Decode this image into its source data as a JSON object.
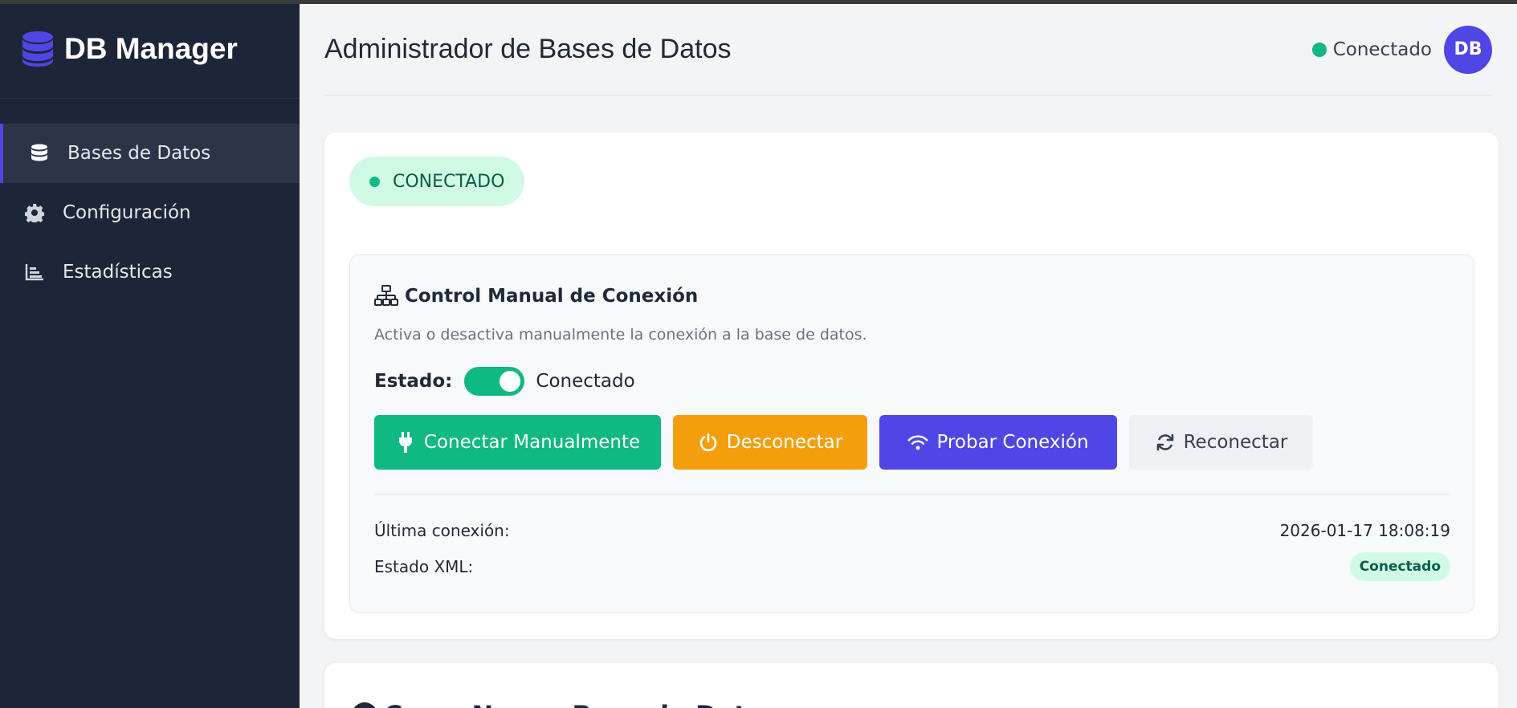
{
  "app": {
    "brand": "DB Manager"
  },
  "sidebar": {
    "items": [
      {
        "label": "Bases de Datos",
        "icon": "database-icon",
        "active": true
      },
      {
        "label": "Configuración",
        "icon": "gear-icon",
        "active": false
      },
      {
        "label": "Estadísticas",
        "icon": "chart-icon",
        "active": false
      }
    ]
  },
  "header": {
    "title": "Administrador de Bases de Datos",
    "status": "Conectado",
    "avatar": "DB"
  },
  "status_card": {
    "pill": "CONECTADO",
    "control": {
      "title": "Control Manual de Conexión",
      "description": "Activa o desactiva manualmente la conexión a la base de datos.",
      "estado_label": "Estado:",
      "estado_value": "Conectado",
      "toggle_on": true,
      "buttons": {
        "connect": "Conectar Manualmente",
        "disconnect": "Desconectar",
        "test": "Probar Conexión",
        "reconnect": "Reconectar"
      },
      "info": {
        "last_connection_label": "Última conexión:",
        "last_connection_value": "2026-01-17 18:08:19",
        "xml_label": "Estado XML:",
        "xml_value": "Conectado"
      }
    }
  },
  "next_card": {
    "title": "Crear Nueva Base de Datos"
  },
  "colors": {
    "sidebar": "#1d2638",
    "accent": "#4f46e5",
    "success": "#10b981",
    "warning": "#f59e0b"
  }
}
